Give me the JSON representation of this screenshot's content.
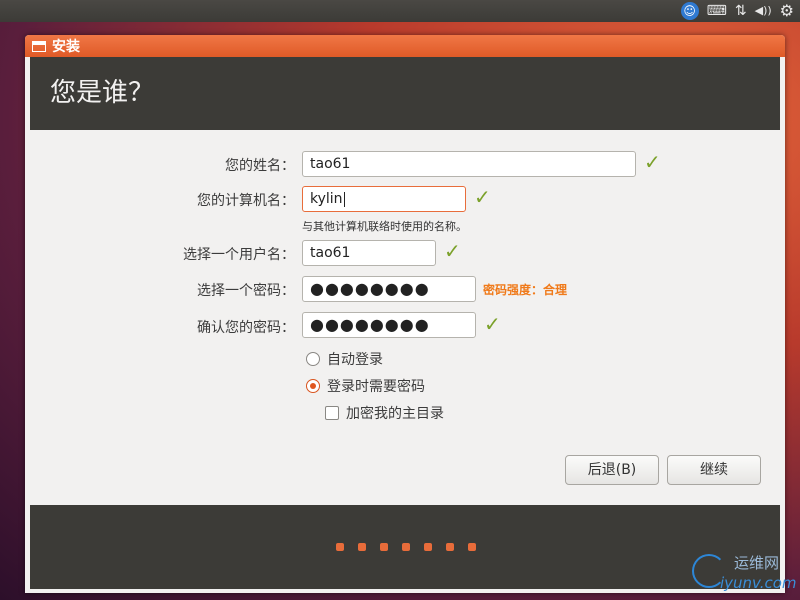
{
  "tray": {
    "icons": [
      "accessibility-icon",
      "keyboard-icon",
      "network-icon",
      "volume-icon",
      "gear-icon"
    ],
    "accessibility_glyph": "☺",
    "keyboard_glyph": "⌨",
    "network_glyph": "⇅",
    "volume_glyph": "◀))",
    "gear_glyph": "⚙"
  },
  "window": {
    "title": "安装"
  },
  "header": {
    "title": "您是谁？"
  },
  "form": {
    "name_label": "您的姓名：",
    "name_value": "tao61",
    "computer_label": "您的计算机名：",
    "computer_value": "kylin",
    "computer_hint": "与其他计算机联络时使用的名称。",
    "username_label": "选择一个用户名：",
    "username_value": "tao61",
    "password_label": "选择一个密码：",
    "password_value": "●●●●●●●●",
    "password_strength": "密码强度：合理",
    "confirm_label": "确认您的密码：",
    "confirm_value": "●●●●●●●●",
    "check_glyph": "✓"
  },
  "login": {
    "auto_label": "自动登录",
    "require_label": "登录时需要密码",
    "encrypt_label": "加密我的主目录",
    "selected": "require"
  },
  "buttons": {
    "back": "后退(B)",
    "continue": "继续"
  },
  "progress": {
    "steps": 7
  },
  "watermark": {
    "cn": "运维网",
    "url": "iyunv.com"
  },
  "colors": {
    "accent": "#e86d3b",
    "header_bg": "#3c3b37",
    "check": "#7ba12a",
    "strength": "#f07a1a"
  }
}
